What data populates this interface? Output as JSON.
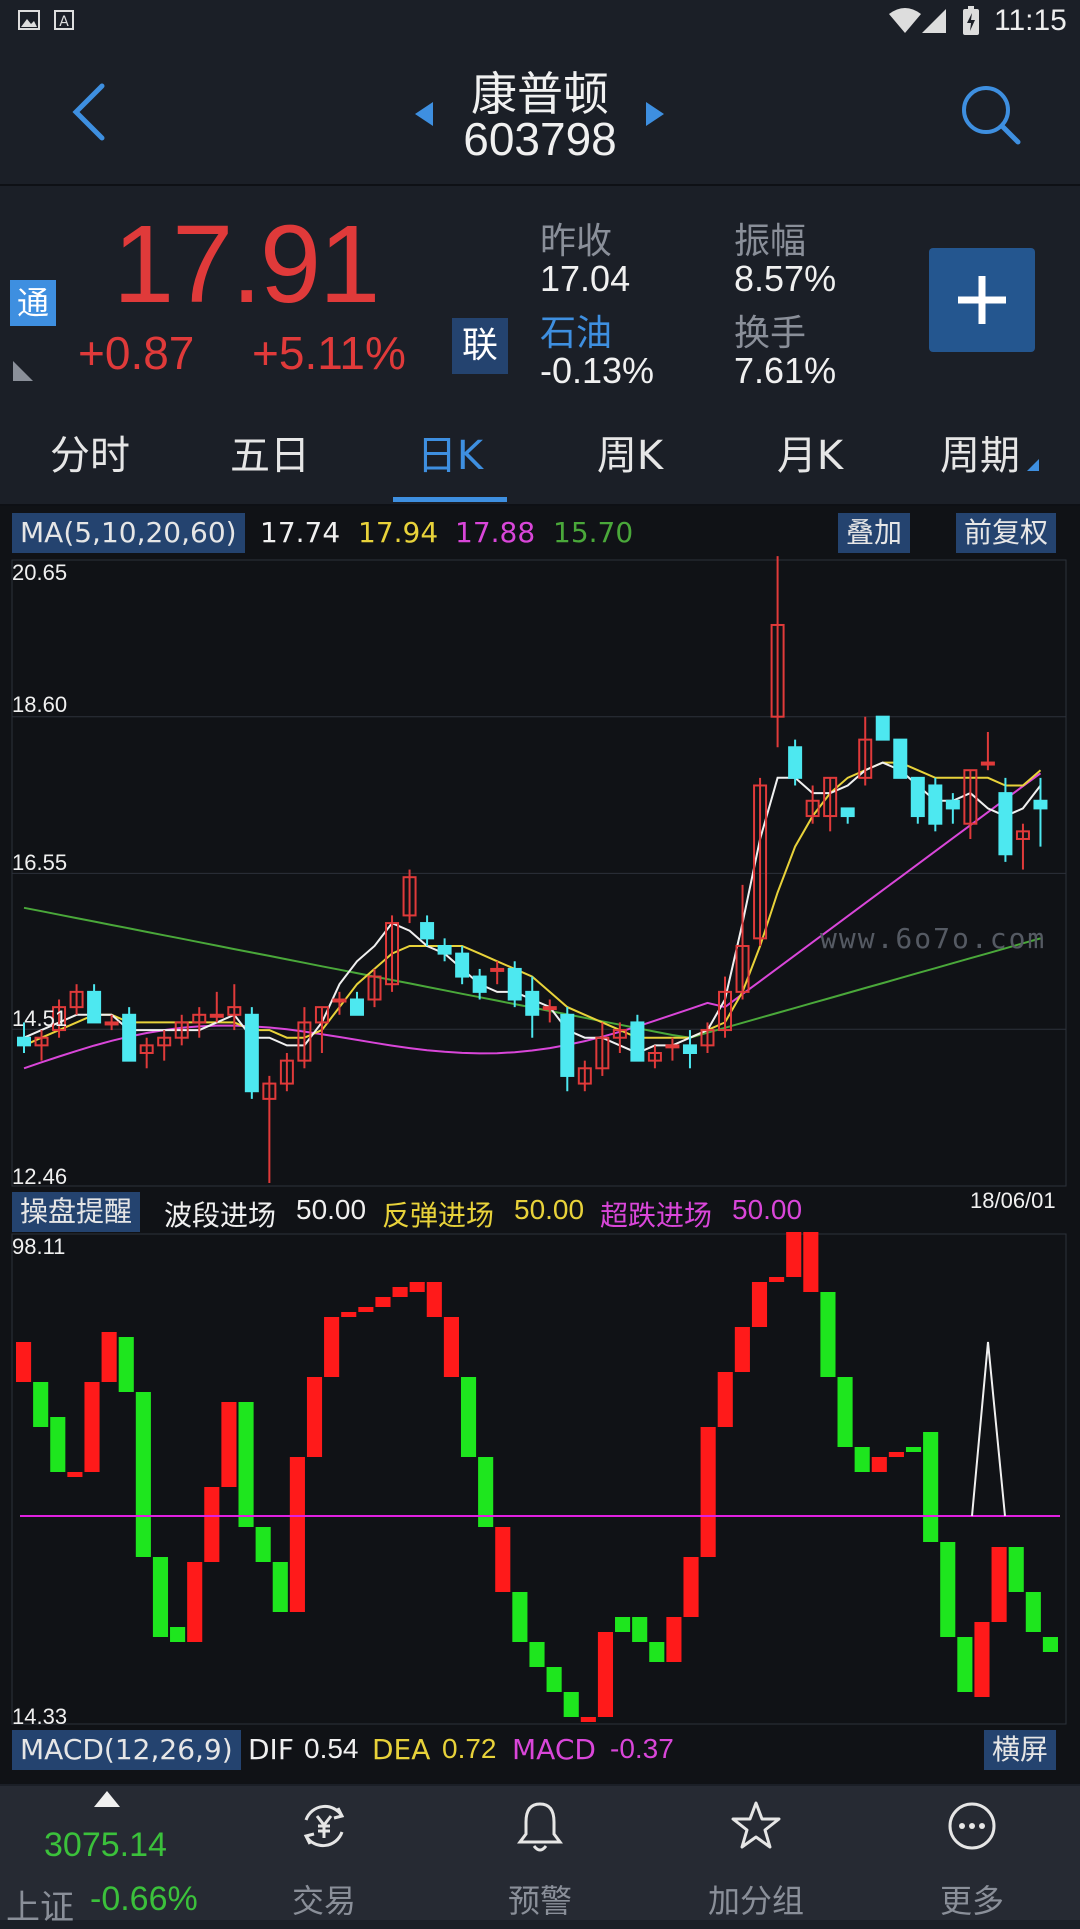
{
  "status_bar": {
    "time": "11:15"
  },
  "header": {
    "name": "康普顿",
    "code": "603798"
  },
  "quote": {
    "tong_badge": "通",
    "price": "17.91",
    "change": "+0.87",
    "change_pct": "+5.11%",
    "lian_badge": "联",
    "prev_close_label": "昨收",
    "prev_close": "17.04",
    "amplitude_label": "振幅",
    "amplitude": "8.57%",
    "sector_label": "石油",
    "sector_change": "-0.13%",
    "turnover_label": "换手",
    "turnover": "7.61%",
    "colors": {
      "up": "#e03a3a",
      "accent": "#3e8fe0"
    }
  },
  "tabs": [
    {
      "label": "分时"
    },
    {
      "label": "五日"
    },
    {
      "label": "日K"
    },
    {
      "label": "周K"
    },
    {
      "label": "月K"
    },
    {
      "label": "周期"
    }
  ],
  "ma_bar": {
    "label": "MA(5,10,20,60)",
    "ma5": "17.74",
    "ma10": "17.94",
    "ma20": "17.88",
    "ma60": "15.70",
    "overlay_button": "叠加",
    "adjust_button": "前复权"
  },
  "kline_axis": {
    "top": "20.65",
    "l2": "18.60",
    "l3": "16.55",
    "l4": "14.51",
    "bottom": "12.46",
    "date": "18/06/01"
  },
  "watermark": "www.6o7o.com",
  "indicator_bar": {
    "label": "操盘提醒",
    "s1_label": "波段进场",
    "s1_value": "50.00",
    "s2_label": "反弹进场",
    "s2_value": "50.00",
    "s3_label": "超跌进场",
    "s3_value": "50.00"
  },
  "indicator_axis": {
    "top": "98.11",
    "bottom": "14.33"
  },
  "macd_bar": {
    "label": "MACD(12,26,9)",
    "dif_label": "DIF",
    "dif": "0.54",
    "dea_label": "DEA",
    "dea": "0.72",
    "macd_label": "MACD",
    "macd": "-0.37",
    "landscape_button": "横屏"
  },
  "bottom_nav": {
    "index_value": "3075.14",
    "index_name": "上证",
    "index_change": "-0.66%",
    "items": [
      {
        "label": "交易",
        "icon": "yen-exchange-icon"
      },
      {
        "label": "预警",
        "icon": "bell-icon"
      },
      {
        "label": "加分组",
        "icon": "star-icon"
      },
      {
        "label": "更多",
        "icon": "more-icon"
      }
    ]
  },
  "chart_data": {
    "type": "candlestick",
    "y_range": [
      12.46,
      20.65
    ],
    "candles": [
      [
        14.4,
        14.6,
        14.2,
        14.3
      ],
      [
        14.3,
        14.5,
        14.1,
        14.4
      ],
      [
        14.5,
        14.9,
        14.4,
        14.8
      ],
      [
        14.8,
        15.1,
        14.7,
        15.0
      ],
      [
        15.0,
        15.1,
        14.6,
        14.6
      ],
      [
        14.6,
        14.7,
        14.5,
        14.6
      ],
      [
        14.7,
        14.8,
        14.1,
        14.1
      ],
      [
        14.2,
        14.4,
        14.0,
        14.3
      ],
      [
        14.3,
        14.5,
        14.1,
        14.4
      ],
      [
        14.4,
        14.7,
        14.3,
        14.6
      ],
      [
        14.6,
        14.8,
        14.4,
        14.7
      ],
      [
        14.7,
        15.0,
        14.6,
        14.7
      ],
      [
        14.7,
        15.1,
        14.5,
        14.8
      ],
      [
        14.7,
        14.8,
        13.6,
        13.7
      ],
      [
        13.6,
        13.9,
        12.5,
        13.8
      ],
      [
        13.8,
        14.2,
        13.7,
        14.1
      ],
      [
        14.1,
        14.8,
        14.0,
        14.6
      ],
      [
        14.6,
        14.8,
        14.2,
        14.8
      ],
      [
        14.9,
        15.0,
        14.7,
        14.9
      ],
      [
        14.9,
        15.0,
        14.7,
        14.7
      ],
      [
        14.9,
        15.3,
        14.8,
        15.2
      ],
      [
        15.1,
        16.0,
        15.0,
        15.9
      ],
      [
        16.0,
        16.6,
        15.9,
        16.5
      ],
      [
        15.9,
        16.0,
        15.6,
        15.7
      ],
      [
        15.6,
        15.7,
        15.4,
        15.5
      ],
      [
        15.5,
        15.6,
        15.1,
        15.2
      ],
      [
        15.2,
        15.3,
        14.9,
        15.0
      ],
      [
        15.3,
        15.4,
        15.1,
        15.3
      ],
      [
        15.3,
        15.4,
        14.8,
        14.9
      ],
      [
        15.0,
        15.2,
        14.4,
        14.7
      ],
      [
        14.8,
        14.9,
        14.6,
        14.8
      ],
      [
        14.7,
        14.8,
        13.7,
        13.9
      ],
      [
        13.8,
        14.1,
        13.7,
        14.0
      ],
      [
        14.0,
        14.6,
        13.9,
        14.4
      ],
      [
        14.4,
        14.6,
        14.2,
        14.5
      ],
      [
        14.6,
        14.7,
        14.1,
        14.1
      ],
      [
        14.1,
        14.3,
        14.0,
        14.2
      ],
      [
        14.3,
        14.4,
        14.1,
        14.3
      ],
      [
        14.3,
        14.5,
        14.0,
        14.2
      ],
      [
        14.3,
        14.6,
        14.2,
        14.5
      ],
      [
        14.5,
        15.2,
        14.4,
        15.0
      ],
      [
        15.0,
        16.4,
        14.9,
        15.6
      ],
      [
        15.7,
        17.8,
        15.6,
        17.7
      ],
      [
        18.6,
        20.7,
        18.2,
        19.8
      ],
      [
        18.2,
        18.3,
        17.7,
        17.8
      ],
      [
        17.3,
        17.7,
        17.2,
        17.5
      ],
      [
        17.3,
        17.8,
        17.1,
        17.8
      ],
      [
        17.4,
        17.4,
        17.2,
        17.3
      ],
      [
        17.8,
        18.6,
        17.7,
        18.3
      ],
      [
        18.6,
        18.6,
        18.3,
        18.3
      ],
      [
        18.3,
        18.3,
        17.8,
        17.8
      ],
      [
        17.8,
        17.8,
        17.2,
        17.3
      ],
      [
        17.7,
        17.8,
        17.1,
        17.2
      ],
      [
        17.5,
        17.6,
        17.2,
        17.4
      ],
      [
        17.2,
        17.9,
        17.0,
        17.9
      ],
      [
        18.0,
        18.4,
        17.9,
        18.0
      ],
      [
        17.6,
        17.8,
        16.7,
        16.8
      ],
      [
        17.0,
        17.2,
        16.6,
        17.1
      ],
      [
        17.5,
        17.8,
        16.9,
        17.4
      ]
    ],
    "ma5": [
      14.4,
      14.5,
      14.6,
      14.7,
      14.7,
      14.7,
      14.5,
      14.5,
      14.5,
      14.5,
      14.5,
      14.6,
      14.7,
      14.4,
      14.4,
      14.3,
      14.3,
      14.6,
      15.1,
      15.4,
      15.6,
      15.9,
      15.8,
      15.6,
      15.5,
      15.3,
      15.1,
      15.0,
      15.0,
      14.9,
      14.8,
      14.5,
      14.4,
      14.4,
      14.3,
      14.2,
      14.3,
      14.3,
      14.4,
      14.5,
      14.9,
      15.9,
      17.0,
      17.8,
      17.8,
      17.6,
      17.6,
      17.7,
      17.9,
      18.0,
      17.9,
      17.7,
      17.5,
      17.5,
      17.6,
      17.4,
      17.3,
      17.4,
      17.7
    ],
    "ma10": [
      14.3,
      14.4,
      14.5,
      14.6,
      14.7,
      14.7,
      14.6,
      14.6,
      14.6,
      14.6,
      14.6,
      14.6,
      14.6,
      14.5,
      14.5,
      14.4,
      14.4,
      14.5,
      14.8,
      15.1,
      15.3,
      15.5,
      15.6,
      15.6,
      15.6,
      15.6,
      15.5,
      15.4,
      15.3,
      15.2,
      15.0,
      14.8,
      14.7,
      14.6,
      14.5,
      14.4,
      14.4,
      14.4,
      14.4,
      14.5,
      14.6,
      15.0,
      15.6,
      16.3,
      16.9,
      17.3,
      17.6,
      17.8,
      17.9,
      18.0,
      18.0,
      17.9,
      17.8,
      17.8,
      17.8,
      17.8,
      17.7,
      17.7,
      17.9
    ]
  }
}
